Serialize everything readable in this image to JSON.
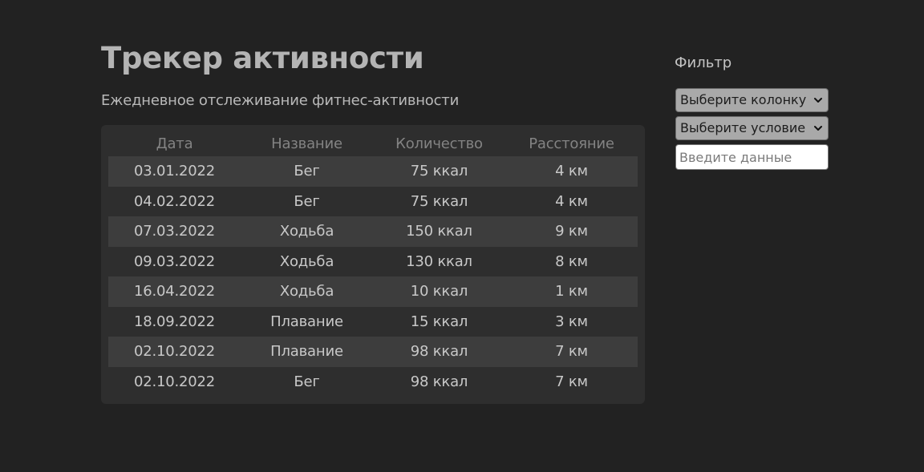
{
  "header": {
    "title": "Трекер активности",
    "subtitle": "Ежедневное отслеживание фитнес-активности"
  },
  "table": {
    "columns": [
      "Дата",
      "Название",
      "Количество",
      "Расстояние"
    ],
    "rows": [
      [
        "03.01.2022",
        "Бег",
        "75 ккал",
        "4 км"
      ],
      [
        "04.02.2022",
        "Бег",
        "75 ккал",
        "4 км"
      ],
      [
        "07.03.2022",
        "Ходьба",
        "150 ккал",
        "9 км"
      ],
      [
        "09.03.2022",
        "Ходьба",
        "130 ккал",
        "8 км"
      ],
      [
        "16.04.2022",
        "Ходьба",
        "10 ккал",
        "1 км"
      ],
      [
        "18.09.2022",
        "Плавание",
        "15 ккал",
        "3 км"
      ],
      [
        "02.10.2022",
        "Плавание",
        "98 ккал",
        "7 км"
      ],
      [
        "02.10.2022",
        "Бег",
        "98 ккал",
        "7 км"
      ]
    ]
  },
  "filter": {
    "label": "Фильтр",
    "column_select": "Выберите колонку",
    "condition_select": "Выберите условие",
    "input_placeholder": "Введите данные",
    "input_value": ""
  },
  "colors": {
    "background": "#222222",
    "card": "#2e2e2e",
    "row_alt": "#3d3d3d",
    "select_bg": "#a9a9a9"
  },
  "icons": {
    "select_chevron": "chevron-down-icon"
  }
}
